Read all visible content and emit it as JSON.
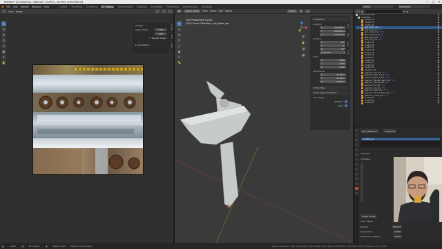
{
  "window": {
    "title": "Blender* [D:\\projects\\...\\Blender_Scythe\\...\\scythe_scene.blend]",
    "controls": [
      "—",
      "□",
      "✕"
    ]
  },
  "menu": {
    "items": [
      "File",
      "Edit",
      "Render",
      "Window",
      "Help"
    ],
    "workspaces": [
      "Layout",
      "Modeling",
      "Sculpting",
      "UV Editing",
      "Texture Paint",
      "Shading",
      "Animation",
      "Rendering",
      "Compositing",
      "Scripting"
    ],
    "active_workspace": "UV Editing",
    "scene": "Scene",
    "view_layer": "ViewLayer"
  },
  "uv_editor": {
    "header": [
      "View",
      "Image"
    ],
    "image_name": "scythe_base_color",
    "display_panel": {
      "title": "Display",
      "aspect_label": "Aspect Ratio",
      "aspect_x": "1.00",
      "aspect_y": "1.00",
      "repeat_label": "Repeat Image",
      "annotations_label": "Annotations"
    },
    "side_tabs": [
      "Image",
      "Tool",
      "View"
    ]
  },
  "viewport": {
    "header": {
      "mode": "Object Mode",
      "items": [
        "View",
        "Select",
        "Add",
        "Object"
      ],
      "transform": "Global"
    },
    "info_line1": "User Perspective (Local)",
    "info_line2": "(229) Scene Collection | sp2_blade_low",
    "gizmo_axes": [
      "X",
      "Y",
      "Z"
    ],
    "side_tabs": [
      "Item",
      "Tool",
      "View",
      "Edit"
    ]
  },
  "npanel": {
    "transform_title": "Transform",
    "location_label": "Location",
    "location": {
      "x": "3.03485 m",
      "y": "-0.00004 m",
      "z": "2.20425 m"
    },
    "rotation_label": "Rotation",
    "rotation": {
      "x": "90°",
      "y": "-0°",
      "z": "90°"
    },
    "rotation_mode": "XYZ Euler",
    "scale_label": "Scale",
    "scale": {
      "x": "1.000",
      "y": "1.000",
      "z": "1.000"
    },
    "dimensions_label": "Dimensions",
    "dimensions": {
      "x": "0.676 m",
      "y": "0.138 m",
      "z": "0.916 m"
    },
    "properties_title": "Properties",
    "auto_apply_title": "Auto Apply Transform",
    "auto_apply_label": "Auto Apply",
    "rotation_check": "Rotation",
    "scale_check": "Scale"
  },
  "outliner": {
    "items": [
      {
        "name": "Scene Collection",
        "color": "#d0d0d0",
        "mod": ""
      },
      {
        "name": "Collection",
        "color": "#d0d0d0",
        "mod": ""
      },
      {
        "name": "model_13",
        "color": "#e59a3a",
        "mod": ""
      },
      {
        "name": "model_14",
        "color": "#e59a3a",
        "mod": ""
      },
      {
        "name": "model_12",
        "color": "#e59a3a",
        "mod": ""
      },
      {
        "name": "sp2_blade_low",
        "color": "#e59a3a",
        "mod": "⚙ ▽",
        "selected": true
      },
      {
        "name": "sp2_bolt_low",
        "color": "#e59a3a",
        "mod": "⚙ ▽"
      },
      {
        "name": "sp2_collar_low",
        "color": "#e59a3a",
        "mod": "⚙ ▽"
      },
      {
        "name": "sp2_handle_low",
        "color": "#e59a3a",
        "mod": "⚙ ▽"
      },
      {
        "name": "sp2_plate_low",
        "color": "#e59a3a",
        "mod": "⚙ ▽"
      },
      {
        "name": "sp2_ring_low",
        "color": "#e59a3a",
        "mod": "⚙ ▽"
      },
      {
        "name": "model_15",
        "color": "#e59a3a",
        "mod": ""
      },
      {
        "name": "model_16",
        "color": "#e59a3a",
        "mod": ""
      },
      {
        "name": "model_17",
        "color": "#e59a3a",
        "mod": ""
      },
      {
        "name": "model_18",
        "color": "#e59a3a",
        "mod": ""
      },
      {
        "name": "model_19",
        "color": "#e59a3a",
        "mod": ""
      },
      {
        "name": "model_20",
        "color": "#e59a3a",
        "mod": ""
      },
      {
        "name": "model_21",
        "color": "#e59a3a",
        "mod": ""
      },
      {
        "name": "model_22",
        "color": "#e59a3a",
        "mod": ""
      },
      {
        "name": "model_23",
        "color": "#e59a3a",
        "mod": ""
      },
      {
        "name": "model_24",
        "color": "#e59a3a",
        "mod": ""
      },
      {
        "name": "model_25",
        "color": "#e59a3a",
        "mod": ""
      },
      {
        "name": "pipeline_14",
        "color": "#e59a3a",
        "mod": ""
      },
      {
        "name": "gearbox_box_low",
        "color": "#e59a3a",
        "mod": "⚙ ▽"
      },
      {
        "name": "gearbox_gear_1_low",
        "color": "#e59a3a",
        "mod": "⚙ ▽"
      },
      {
        "name": "gearbox_gear_2_low",
        "color": "#e59a3a",
        "mod": "⚙ ▽"
      },
      {
        "name": "gearbox_handle_main_low",
        "color": "#e59a3a",
        "mod": "⚙ ▽"
      },
      {
        "name": "gearbox_handle_low",
        "color": "#e59a3a",
        "mod": "⚙ ▽"
      },
      {
        "name": "gearbox_lid_low",
        "color": "#e59a3a",
        "mod": "⚙ ▽"
      },
      {
        "name": "gearbox_pin_low",
        "color": "#e59a3a",
        "mod": "⚙ ▽"
      },
      {
        "name": "gearbox_plate_low",
        "color": "#e59a3a",
        "mod": "⚙ ▽"
      },
      {
        "name": "gearbox_pack_holder_low",
        "color": "#e59a3a",
        "mod": "⚙ ▽"
      },
      {
        "name": "gearbox_screw_low",
        "color": "#e59a3a",
        "mod": "⚙ ▽"
      },
      {
        "name": "model_27",
        "color": "#e59a3a",
        "mod": ""
      },
      {
        "name": "model_28",
        "color": "#e59a3a",
        "mod": ""
      },
      {
        "name": "model_29",
        "color": "#e59a3a",
        "mod": ""
      }
    ]
  },
  "properties": {
    "object_name": "sp2_blade_low",
    "material_name": "scythe_01",
    "slot_name": "scythe_01",
    "preview_title": "Preview",
    "surface_title": "Surface",
    "image_node": "Single Image",
    "color_space_label": "Color Space",
    "color_space": "sRGB",
    "normal_label": "Normal",
    "normal_value": "Default",
    "subsurface_label": "Subsurface",
    "subsurface_value": "0.000",
    "subsurface_radius_label": "Subsurface Radius",
    "subsurface_radius": "1.000"
  },
  "status": {
    "select": "Select",
    "box_select": "Box Select",
    "rotate_view": "Rotate View",
    "object_menu": "Object Context Menu",
    "stats": "Scene Collection | sp2_blade_low | Verts 384/11,894 | Faces 192/5,827 | Tris 384/11,740 | Objects 1/30 | 2.93.3"
  }
}
